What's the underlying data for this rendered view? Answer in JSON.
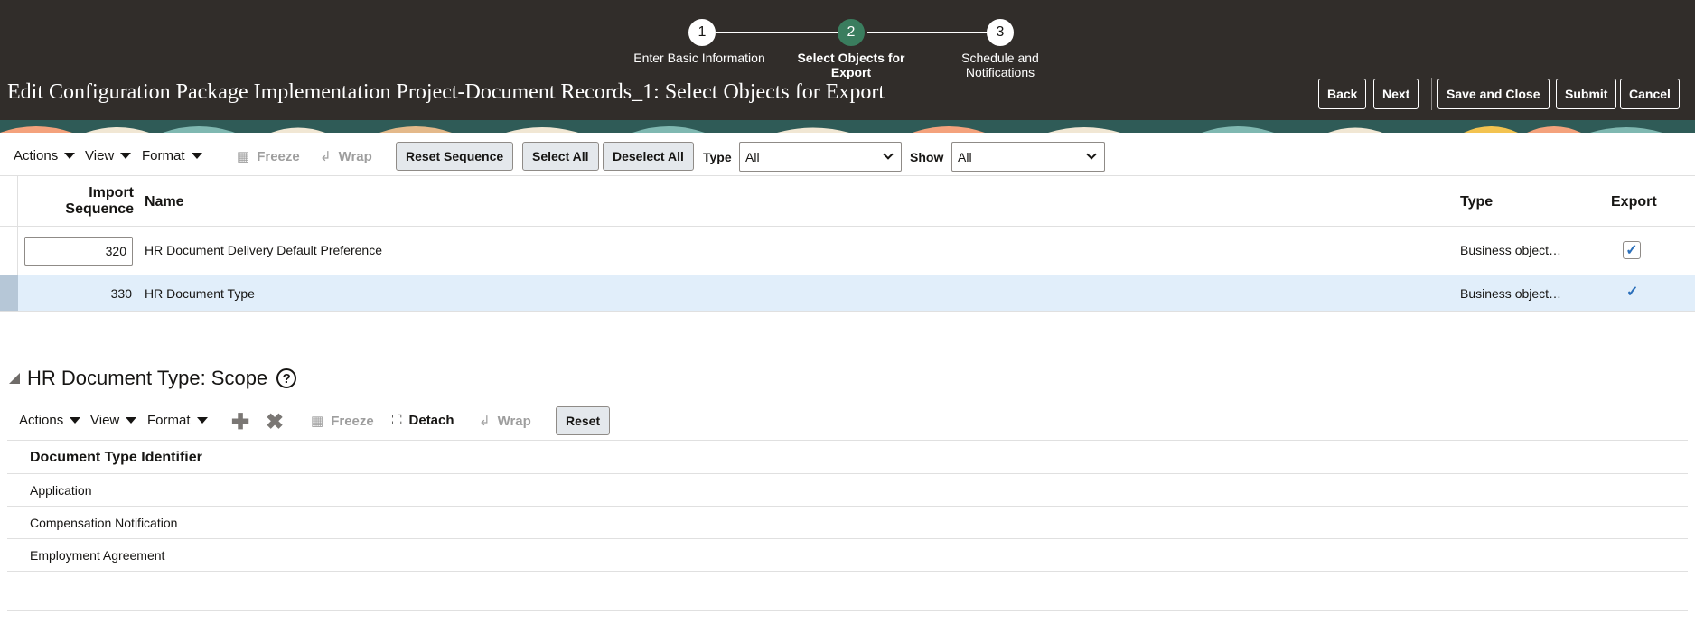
{
  "train": {
    "steps": [
      {
        "number": "1",
        "label_line1": "Enter Basic Information",
        "label_line2": ""
      },
      {
        "number": "2",
        "label_line1": "Select Objects for",
        "label_line2": "Export"
      },
      {
        "number": "3",
        "label_line1": "Schedule and",
        "label_line2": "Notifications"
      }
    ],
    "active_step": 2
  },
  "page": {
    "title": "Edit Configuration Package Implementation Project-Document Records_1: Select Objects for Export"
  },
  "header_buttons": {
    "back": "Back",
    "next": "Next",
    "save_and_close": "Save and Close",
    "submit": "Submit",
    "cancel": "Cancel"
  },
  "toolbar": {
    "actions": "Actions",
    "view": "View",
    "format": "Format",
    "freeze": "Freeze",
    "wrap": "Wrap",
    "reset_sequence": "Reset Sequence",
    "select_all": "Select All",
    "deselect_all": "Deselect All",
    "type_label": "Type",
    "type_value": "All",
    "show_label": "Show",
    "show_value": "All"
  },
  "main_table": {
    "columns": {
      "import_sequence_line1": "Import",
      "import_sequence_line2": "Sequence",
      "name": "Name",
      "type": "Type",
      "export": "Export"
    },
    "rows": [
      {
        "sequence": "320",
        "name": "HR Document Delivery Default Preference",
        "type": "Business object…",
        "export": true,
        "editing": true
      },
      {
        "sequence": "330",
        "name": "HR Document Type",
        "type": "Business object…",
        "export": true,
        "selected": true
      }
    ]
  },
  "scope": {
    "title": "HR Document Type: Scope",
    "toolbar": {
      "actions": "Actions",
      "view": "View",
      "format": "Format",
      "freeze": "Freeze",
      "detach": "Detach",
      "wrap": "Wrap",
      "reset": "Reset"
    },
    "column": "Document Type Identifier",
    "rows": [
      "Application",
      "Compensation Notification",
      "Employment Agreement"
    ]
  },
  "colors": {
    "header_bg": "#312d2a",
    "active_step": "#3a7d5e",
    "selected_row": "#e1eefa",
    "check": "#2b6fba"
  }
}
